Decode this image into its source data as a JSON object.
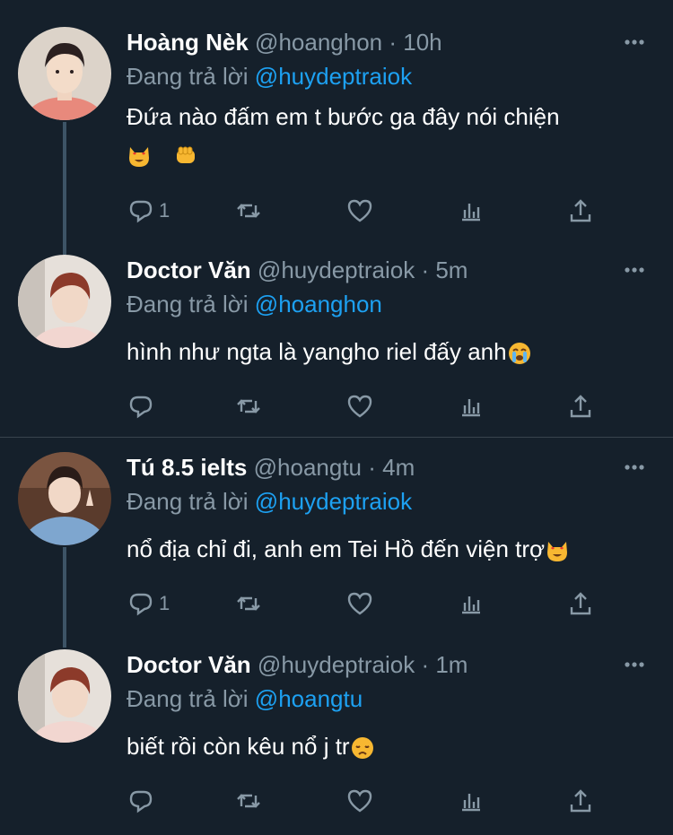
{
  "tweets": [
    {
      "name": "Hoàng Nèk",
      "handle": "@hoanghon",
      "time": "10h",
      "reply_prefix": "Đang trả lời",
      "reply_to": "@huydeptraiok",
      "text": "Đứa nào đấm em t  bước ga đây nói chiện",
      "emojis": [
        "heart-eyes-cat",
        "fist"
      ],
      "reply_count": "1"
    },
    {
      "name": "Doctor Văn",
      "handle": "@huydeptraiok",
      "time": "5m",
      "reply_prefix": "Đang trả lời",
      "reply_to": "@hoanghon",
      "text": "hình như ngta là yangho riel đấy anh",
      "emojis": [
        "crying-face"
      ],
      "reply_count": ""
    },
    {
      "name": "Tú 8.5 ielts",
      "handle": "@hoangtu",
      "time": "4m",
      "reply_prefix": "Đang trả lời",
      "reply_to": "@huydeptraiok",
      "text": "nổ địa chỉ đi, anh em Tei Hồ đến viện trợ",
      "emojis": [
        "heart-eyes-cat"
      ],
      "reply_count": "1"
    },
    {
      "name": "Doctor Văn",
      "handle": "@huydeptraiok",
      "time": "1m",
      "reply_prefix": "Đang trả lời",
      "reply_to": "@hoangtu",
      "text": "biết rồi còn kêu nổ j tr",
      "emojis": [
        "disappointed-face"
      ],
      "reply_count": ""
    }
  ],
  "separator_dot": "·",
  "colors": {
    "background": "#15202b",
    "secondary_text": "#8899a6",
    "mention": "#1da1f2",
    "thread_line": "#3d5466",
    "divider": "#38444d"
  }
}
